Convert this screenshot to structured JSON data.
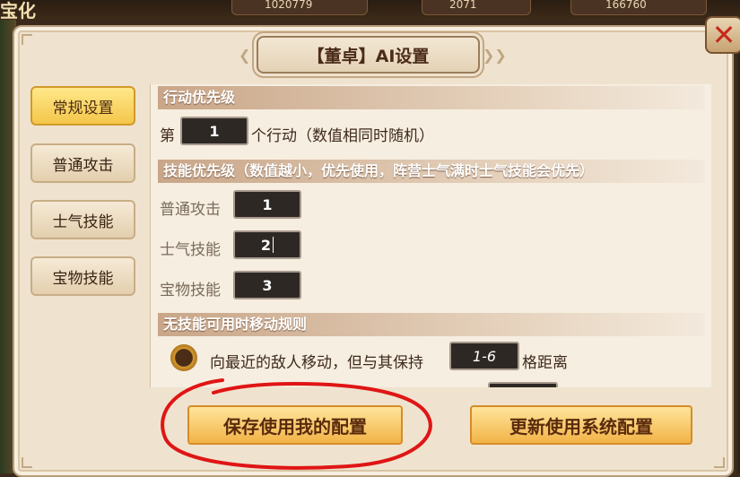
{
  "background": {
    "title_fragment": "宝化",
    "resources": [
      {
        "value": "1020779"
      },
      {
        "value": "2071"
      },
      {
        "value": "166760"
      }
    ]
  },
  "dialog": {
    "title": "【董卓】AI设置",
    "close_icon": "close-icon"
  },
  "tabs": [
    {
      "label": "常规设置",
      "active": true
    },
    {
      "label": "普通攻击",
      "active": false
    },
    {
      "label": "士气技能",
      "active": false
    },
    {
      "label": "宝物技能",
      "active": false
    }
  ],
  "action_priority": {
    "header": "行动优先级",
    "prefix": "第",
    "value": "1",
    "suffix": "个行动（数值相同时随机）"
  },
  "skill_priority": {
    "header": "技能优先级（数值越小，优先使用，阵营士气满时士气技能会优先）",
    "rows": [
      {
        "label": "普通攻击",
        "value": "1"
      },
      {
        "label": "士气技能",
        "value": "2"
      },
      {
        "label": "宝物技能",
        "value": "3"
      }
    ]
  },
  "move_rule": {
    "header": "无技能可用时移动规则",
    "option_text": "向最近的敌人移动，但与其保持",
    "range_value": "1-6",
    "range_suffix": "格距离"
  },
  "buttons": {
    "save_mine": "保存使用我的配置",
    "use_system": "更新使用系统配置"
  },
  "colors": {
    "accent": "#f3c64a",
    "annotation": "#e01515",
    "close": "#c8281c"
  }
}
